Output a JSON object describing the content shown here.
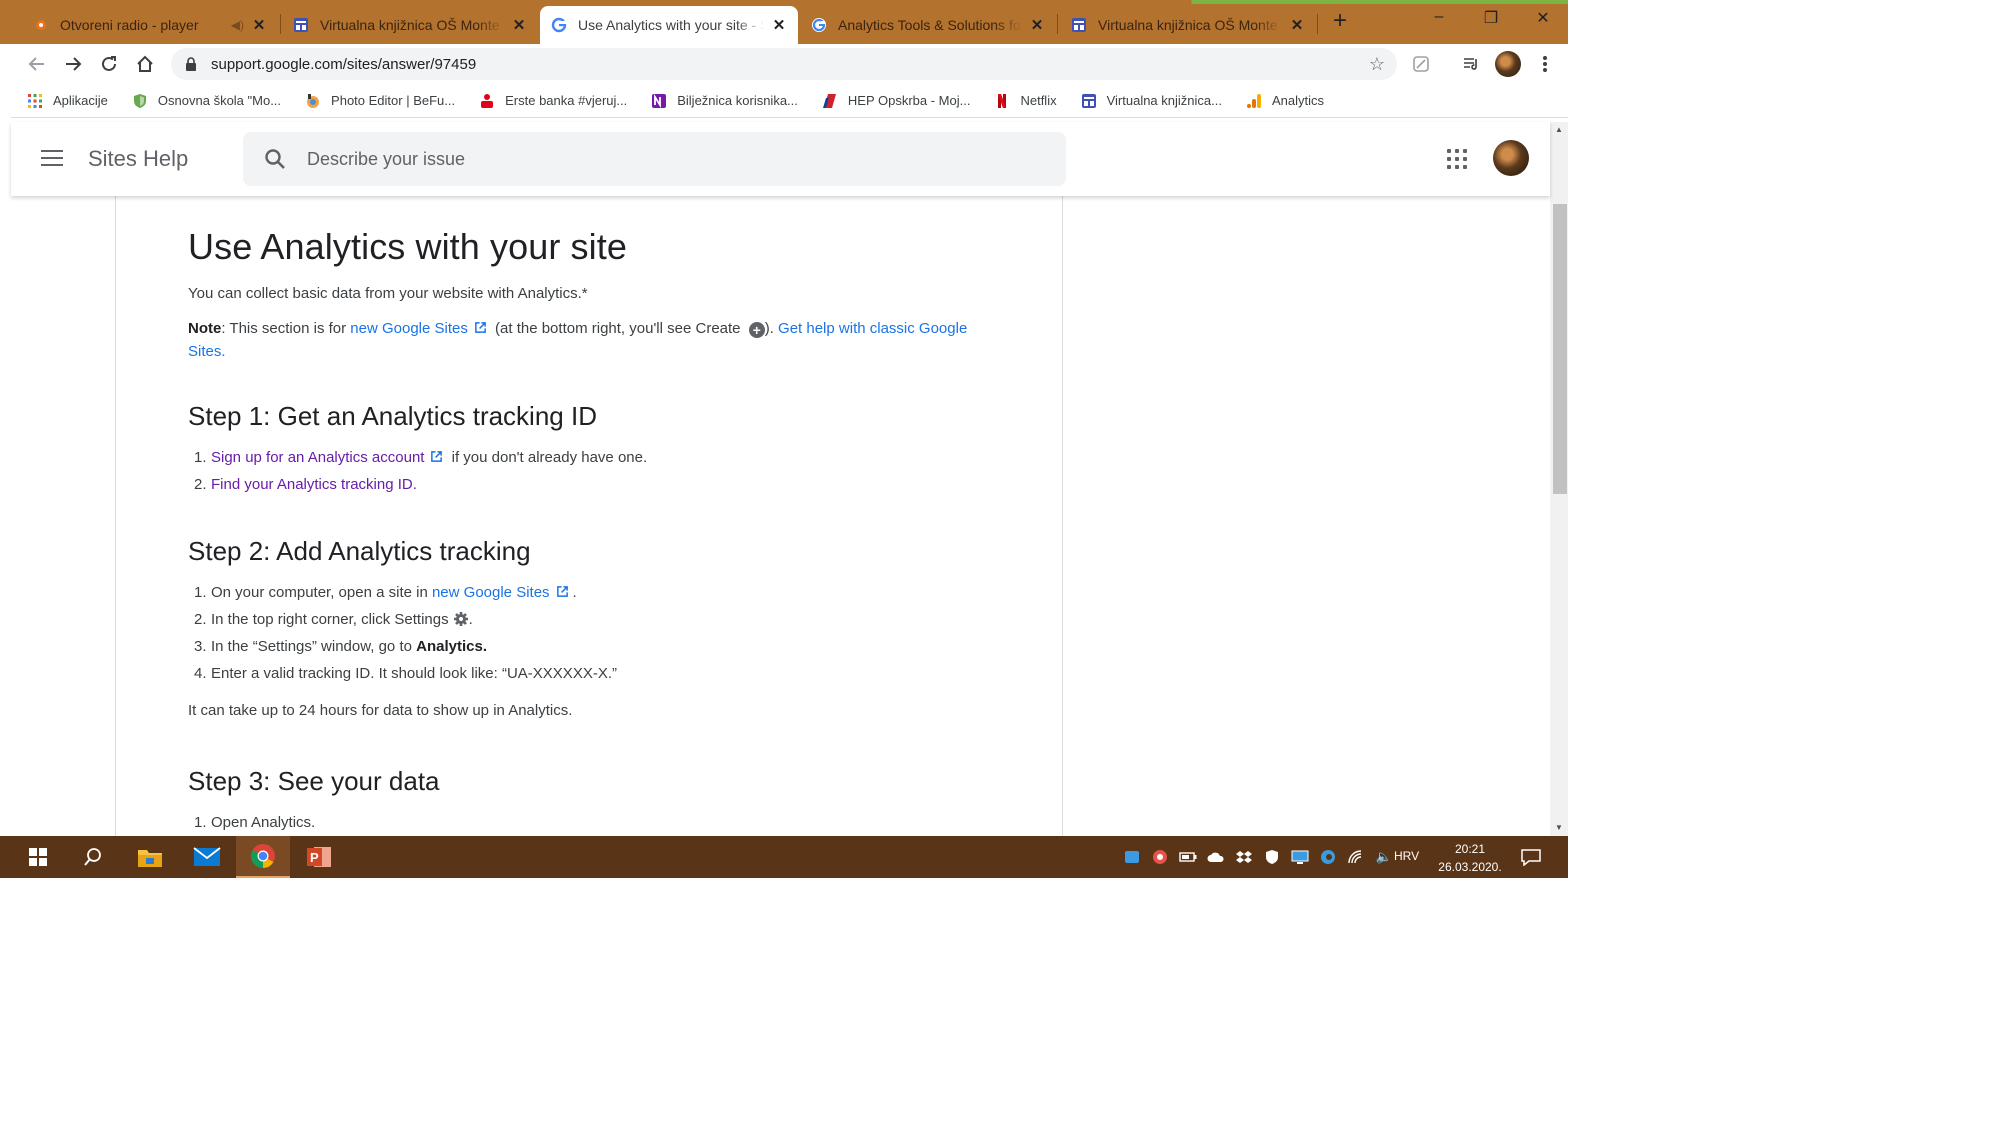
{
  "browser": {
    "tabs": [
      {
        "label": "Otvoreni radio - player",
        "icon": "radio-icon",
        "sound": true,
        "active": false
      },
      {
        "label": "Virtualna knjižnica OŠ Monte Z",
        "icon": "sites-icon",
        "active": false
      },
      {
        "label": "Use Analytics with your site - S",
        "icon": "google-g-icon",
        "active": true
      },
      {
        "label": "Analytics Tools & Solutions for",
        "icon": "google-g-icon",
        "active": false
      },
      {
        "label": "Virtualna knjižnica OŠ Monte Z",
        "icon": "sites-icon",
        "active": false
      }
    ],
    "new_tab": "+",
    "window_controls": {
      "minimize": "–",
      "restore": "❐",
      "close": "✕"
    },
    "url": "support.google.com/sites/answer/97459",
    "bookmarks": [
      {
        "label": "Aplikacije",
        "icon": "apps-grid-icon",
        "color": "#e94235"
      },
      {
        "label": "Osnovna škola \"Mo...",
        "icon": "shield-icon",
        "color": "#6aa84f"
      },
      {
        "label": "Photo Editor | BeFu...",
        "icon": "befunky-icon",
        "color": "#f4a340"
      },
      {
        "label": "Erste banka #vjeruj...",
        "icon": "erste-icon",
        "color": "#e2001a"
      },
      {
        "label": "Bilježnica korisnika...",
        "icon": "onenote-icon",
        "color": "#7719aa"
      },
      {
        "label": "HEP Opskrba - Moj...",
        "icon": "hep-icon",
        "color": "#d3212c"
      },
      {
        "label": "Netflix",
        "icon": "netflix-icon",
        "color": "#e50914"
      },
      {
        "label": "Virtualna knjižnica...",
        "icon": "sites-icon",
        "color": "#3f51b5"
      },
      {
        "label": "Analytics",
        "icon": "analytics-icon",
        "color": "#f9ab00"
      }
    ]
  },
  "help_header": {
    "title": "Sites Help",
    "search_placeholder": "Describe your issue"
  },
  "article": {
    "title": "Use Analytics with your site",
    "intro": "You can collect basic data from your website with Analytics.*",
    "note": {
      "label": "Note",
      "text_before_link": ": This section is for ",
      "link1": "new Google Sites",
      "text_after_link": " (at the bottom right, you'll see Create ",
      "text_close": "). ",
      "link2": "Get help with classic Google Sites",
      "end": "."
    },
    "step1": {
      "heading": "Step 1: Get an Analytics tracking ID",
      "items": [
        {
          "num": "1.",
          "link": "Sign up for an Analytics account",
          "rest": " if you don't already have one."
        },
        {
          "num": "2.",
          "link": "Find your Analytics tracking ID",
          "rest": "."
        }
      ]
    },
    "step2": {
      "heading": "Step 2: Add Analytics tracking",
      "item1": {
        "num": "1.",
        "text": "On your computer, open a site in ",
        "link": "new Google Sites",
        "rest": "."
      },
      "item2": {
        "num": "2.",
        "text": "In the top right corner, click Settings",
        "rest": "."
      },
      "item3": {
        "num": "3.",
        "text": "In the “Settings” window, go to ",
        "bold": "Analytics."
      },
      "item4": {
        "num": "4.",
        "text": "Enter a valid tracking ID. It should look like: “UA-XXXXXX-X.”"
      },
      "footer": "It can take up to 24 hours for data to show up in Analytics."
    },
    "step3": {
      "heading": "Step 3: See your data",
      "items": [
        {
          "num": "1.",
          "text": "Open Analytics."
        }
      ]
    }
  },
  "taskbar": {
    "apps": [
      {
        "name": "start",
        "icon": "windows-logo-icon"
      },
      {
        "name": "search",
        "icon": "search-icon"
      },
      {
        "name": "file-explorer",
        "icon": "folder-icon"
      },
      {
        "name": "mail",
        "icon": "mail-icon"
      },
      {
        "name": "chrome",
        "icon": "chrome-icon",
        "active": true
      },
      {
        "name": "powerpoint",
        "icon": "powerpoint-icon"
      }
    ],
    "language": "HRV",
    "time": "20:21",
    "date": "26.03.2020."
  },
  "colors": {
    "tabstrip": "#b4722f",
    "taskbar": "#5a3416",
    "link": "#1a73e8",
    "visited_link": "#681da8"
  }
}
